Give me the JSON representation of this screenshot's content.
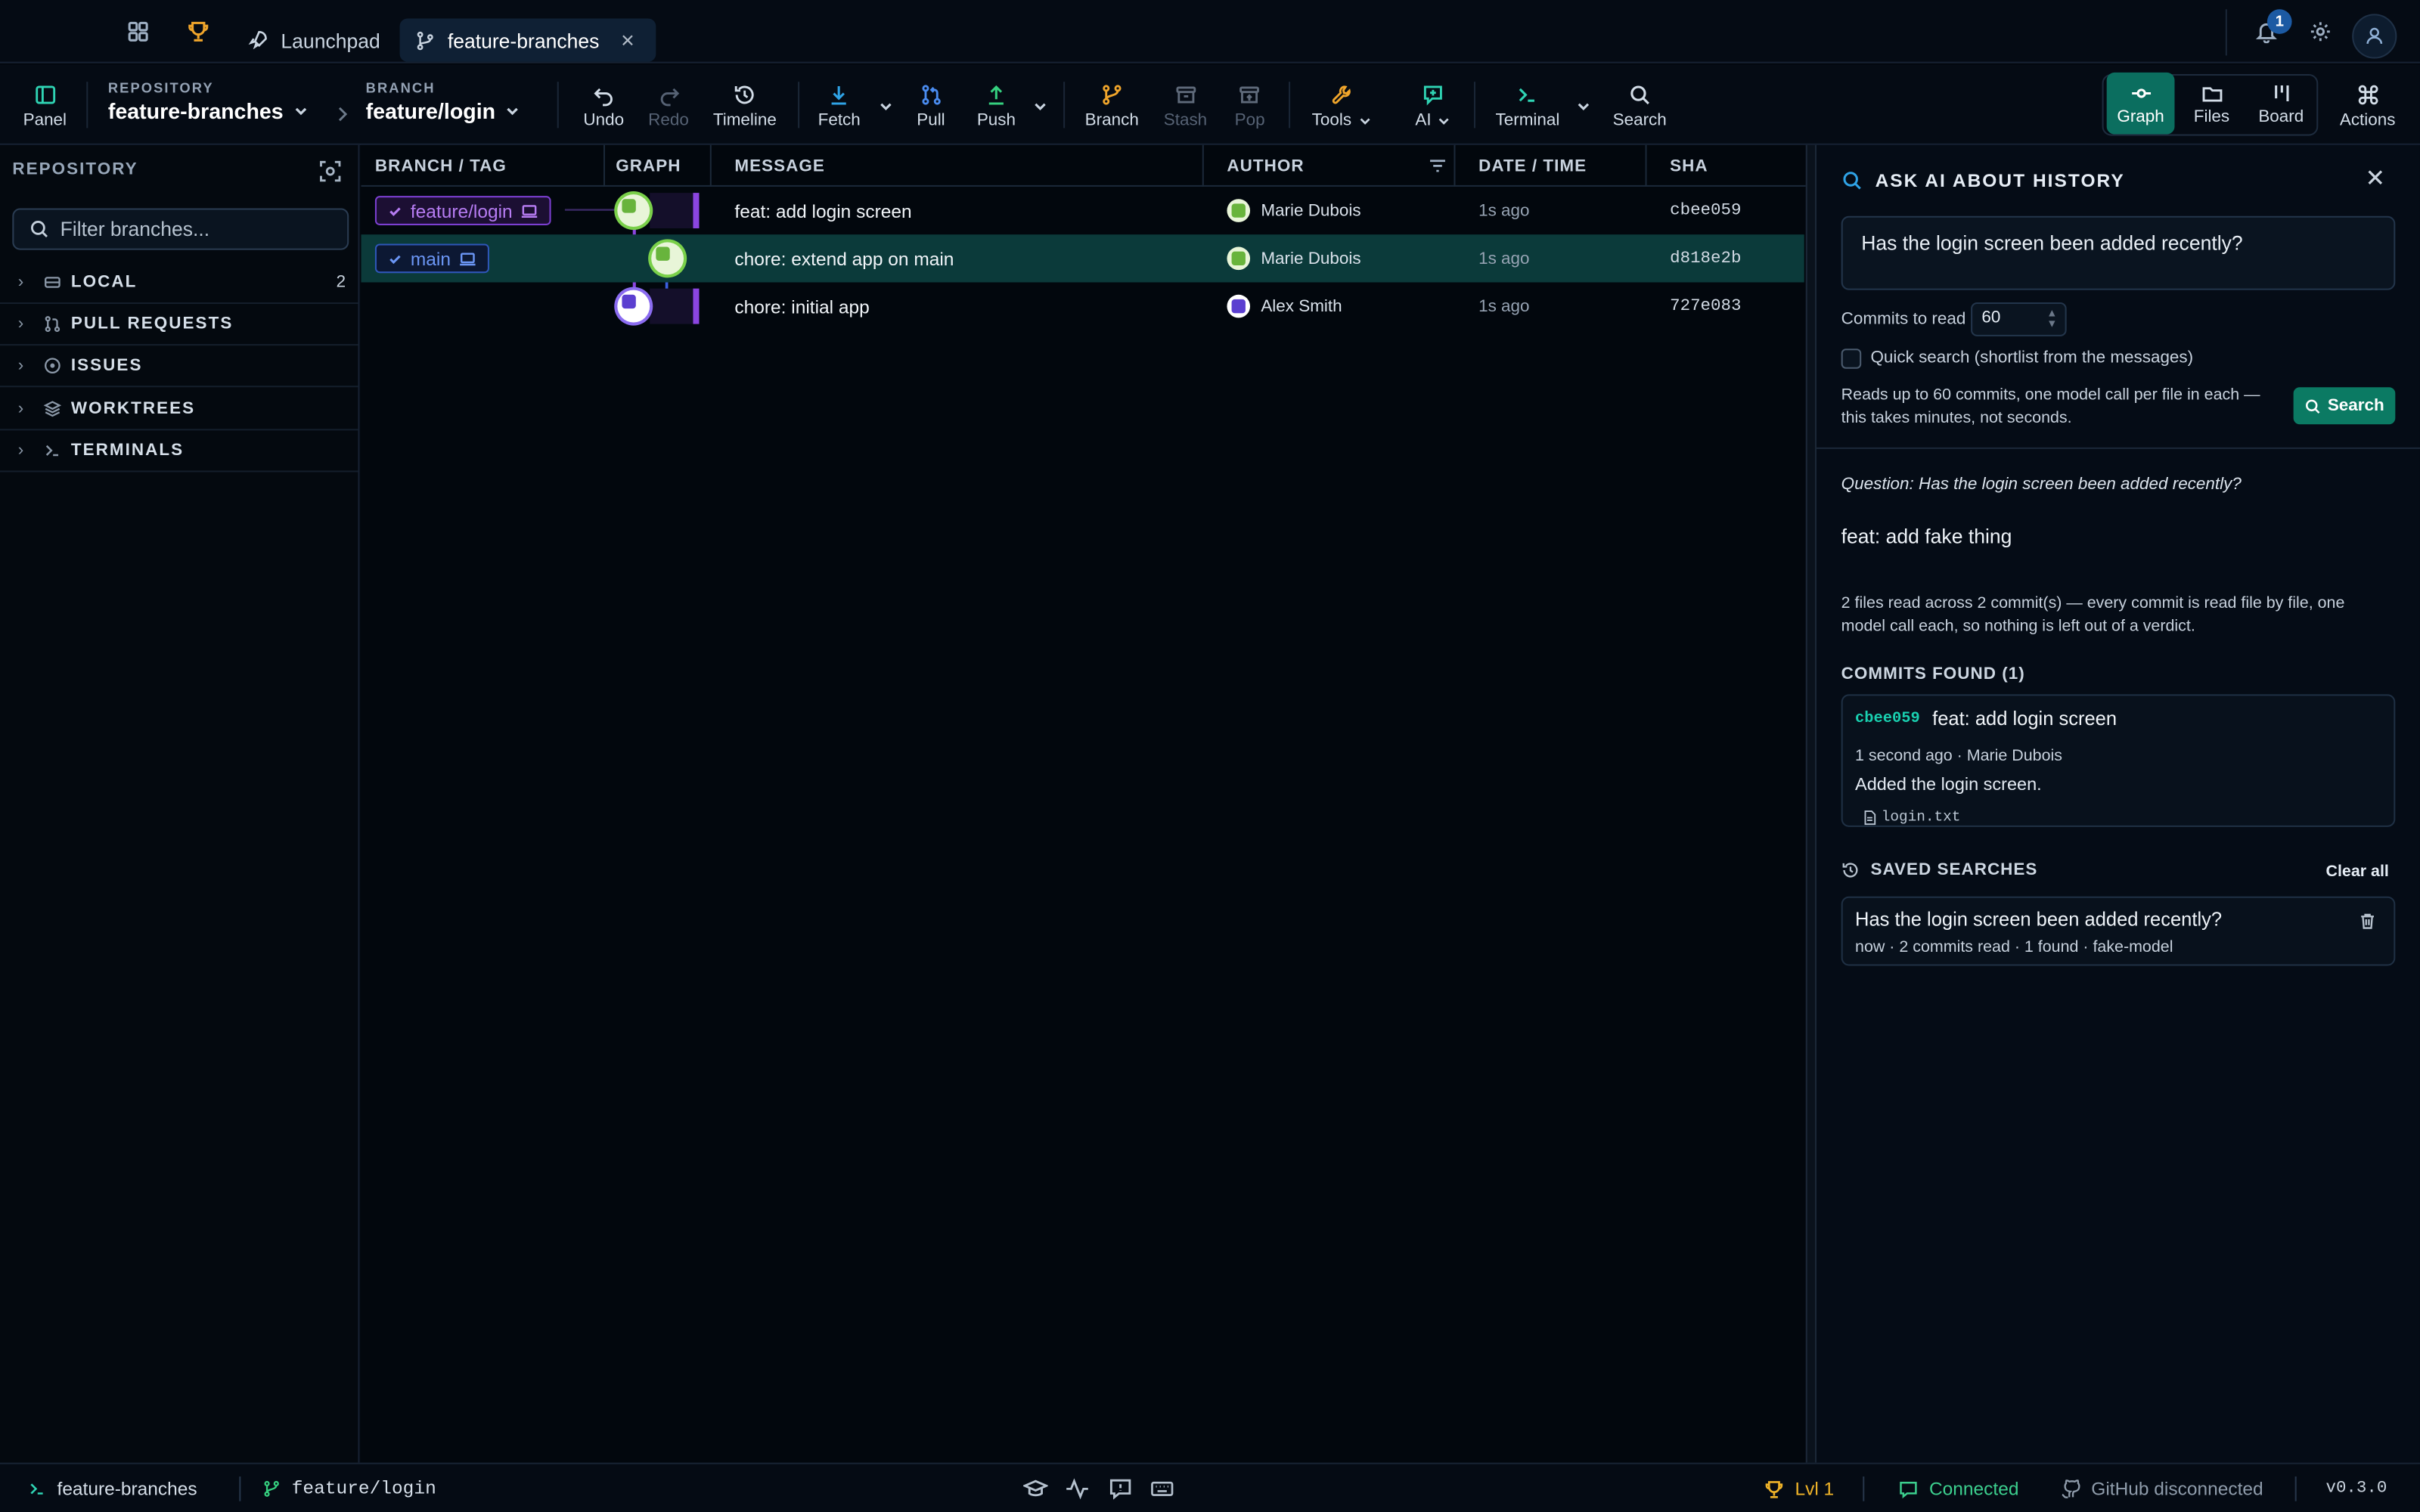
{
  "tabs": {
    "launchpad": "Launchpad",
    "repo": "feature-branches"
  },
  "notifications": {
    "count": "1"
  },
  "toolbar": {
    "panel": "Panel",
    "repository_caption": "REPOSITORY",
    "repository_value": "feature-branches",
    "branch_caption": "BRANCH",
    "branch_value": "feature/login",
    "undo": "Undo",
    "redo": "Redo",
    "timeline": "Timeline",
    "fetch": "Fetch",
    "pull": "Pull",
    "push": "Push",
    "branch": "Branch",
    "stash": "Stash",
    "pop": "Pop",
    "tools": "Tools",
    "ai": "AI",
    "terminal": "Terminal",
    "search": "Search",
    "view_graph": "Graph",
    "view_files": "Files",
    "view_board": "Board",
    "actions": "Actions"
  },
  "sidebar": {
    "header": "REPOSITORY",
    "filter_placeholder": "Filter branches...",
    "sections": [
      {
        "label": "LOCAL",
        "count": "2"
      },
      {
        "label": "PULL REQUESTS"
      },
      {
        "label": "ISSUES"
      },
      {
        "label": "WORKTREES"
      },
      {
        "label": "TERMINALS"
      }
    ]
  },
  "table": {
    "columns": {
      "branch": "BRANCH / TAG",
      "graph": "GRAPH",
      "message": "MESSAGE",
      "author": "AUTHOR",
      "date": "DATE / TIME",
      "sha": "SHA"
    },
    "rows": [
      {
        "branch": "feature/login",
        "message": "feat: add login screen",
        "author": "Marie Dubois",
        "date": "1s ago",
        "sha": "cbee059"
      },
      {
        "branch": "main",
        "message": "chore: extend app on main",
        "author": "Marie Dubois",
        "date": "1s ago",
        "sha": "d818e2b"
      },
      {
        "branch": "",
        "message": "chore: initial app",
        "author": "Alex Smith",
        "date": "1s ago",
        "sha": "727e083"
      }
    ]
  },
  "ai_panel": {
    "title": "ASK AI ABOUT HISTORY",
    "question": "Has the login screen been added recently?",
    "commits_label": "Commits to read",
    "commits_value": "60",
    "quick_search": "Quick search (shortlist from the messages)",
    "reads_note": "Reads up to 60 commits, one model call per file in each — this takes minutes, not seconds.",
    "search_button": "Search",
    "question_line": "Question: Has the login screen been added recently?",
    "answer": "feat: add fake thing",
    "files_note": "2 files read across 2 commit(s) — every commit is read file by file, one model call each, so nothing is left out of a verdict.",
    "commits_found": "COMMITS FOUND (1)",
    "result": {
      "sha": "cbee059",
      "message": "feat: add login screen",
      "meta": "1 second ago · Marie Dubois",
      "body": "Added the login screen.",
      "file": "login.txt"
    },
    "saved_title": "SAVED SEARCHES",
    "clear_all": "Clear all",
    "saved": {
      "question": "Has the login screen been added recently?",
      "meta": "now · 2 commits read · 1 found · fake-model"
    }
  },
  "statusbar": {
    "repo": "feature-branches",
    "branch": "feature/login",
    "level": "Lvl 1",
    "connection": "Connected",
    "github": "GitHub disconnected",
    "version": "v0.3.0"
  },
  "colors": {
    "accent": "#0b7a63",
    "feature_branch": "#8b45e0",
    "main_branch": "#3b63e6",
    "connected": "#3ccf8e",
    "level": "#f0b429"
  }
}
